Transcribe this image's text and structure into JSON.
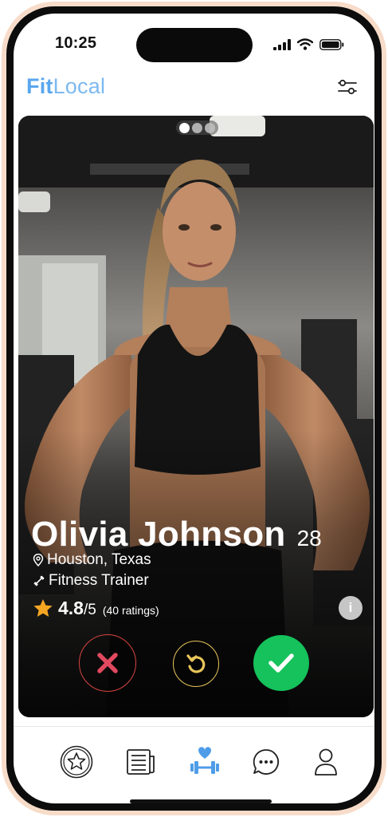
{
  "status_bar": {
    "time": "10:25"
  },
  "header": {
    "brand_part1": "Fit",
    "brand_part2": "Local",
    "filter_icon": "sliders-icon"
  },
  "card": {
    "photo_count": 3,
    "active_photo": 1,
    "name": "Olivia Johnson",
    "age": "28",
    "location": "Houston, Texas",
    "role": "Fitness Trainer",
    "rating": "4.8",
    "rating_scale": "/5",
    "rating_count": "(40 ratings)",
    "info_label": "i"
  },
  "actions": {
    "reject_icon": "x-icon",
    "undo_icon": "undo-icon",
    "accept_icon": "check-icon"
  },
  "colors": {
    "brand": "#5aa6ee",
    "accept": "#15c25b",
    "reject": "#e0495f",
    "undo": "#e8c55a",
    "star": "#f5a623"
  },
  "nav": {
    "items": [
      {
        "name": "favorites",
        "icon": "star-circle-icon"
      },
      {
        "name": "news",
        "icon": "newspaper-icon"
      },
      {
        "name": "discover",
        "icon": "dumbbell-heart-icon",
        "active": true
      },
      {
        "name": "messages",
        "icon": "chat-icon"
      },
      {
        "name": "profile",
        "icon": "user-icon"
      }
    ]
  }
}
